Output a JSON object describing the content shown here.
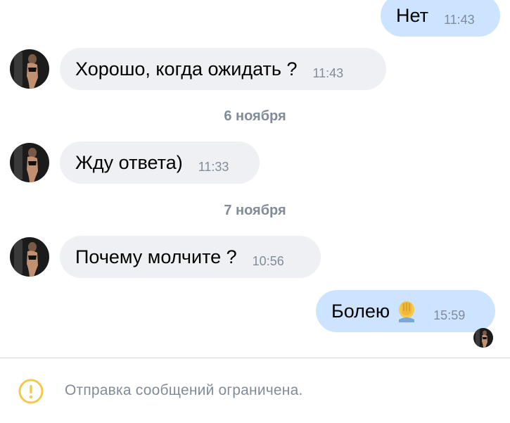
{
  "messages": [
    {
      "text": "Нет",
      "time": "11:43",
      "direction": "outgoing"
    },
    {
      "text": "Хорошо, когда ожидать ?",
      "time": "11:43",
      "direction": "incoming"
    },
    {
      "date": "6 ноября"
    },
    {
      "text": "Жду ответа)",
      "time": "11:33",
      "direction": "incoming"
    },
    {
      "date": "7 ноября"
    },
    {
      "text": "Почему молчите ?",
      "time": "10:56",
      "direction": "incoming"
    },
    {
      "text": "Болею",
      "time": "15:59",
      "direction": "outgoing",
      "emoji": "face-palm-emoji"
    }
  ],
  "footer": {
    "notice": "Отправка сообщений ограничена.",
    "icon": "warning-circle-icon",
    "icon_color": "#f2c94c"
  },
  "colors": {
    "incoming_bubble": "#eff0f3",
    "outgoing_bubble": "#cce4ff",
    "timestamp": "#818c99"
  }
}
